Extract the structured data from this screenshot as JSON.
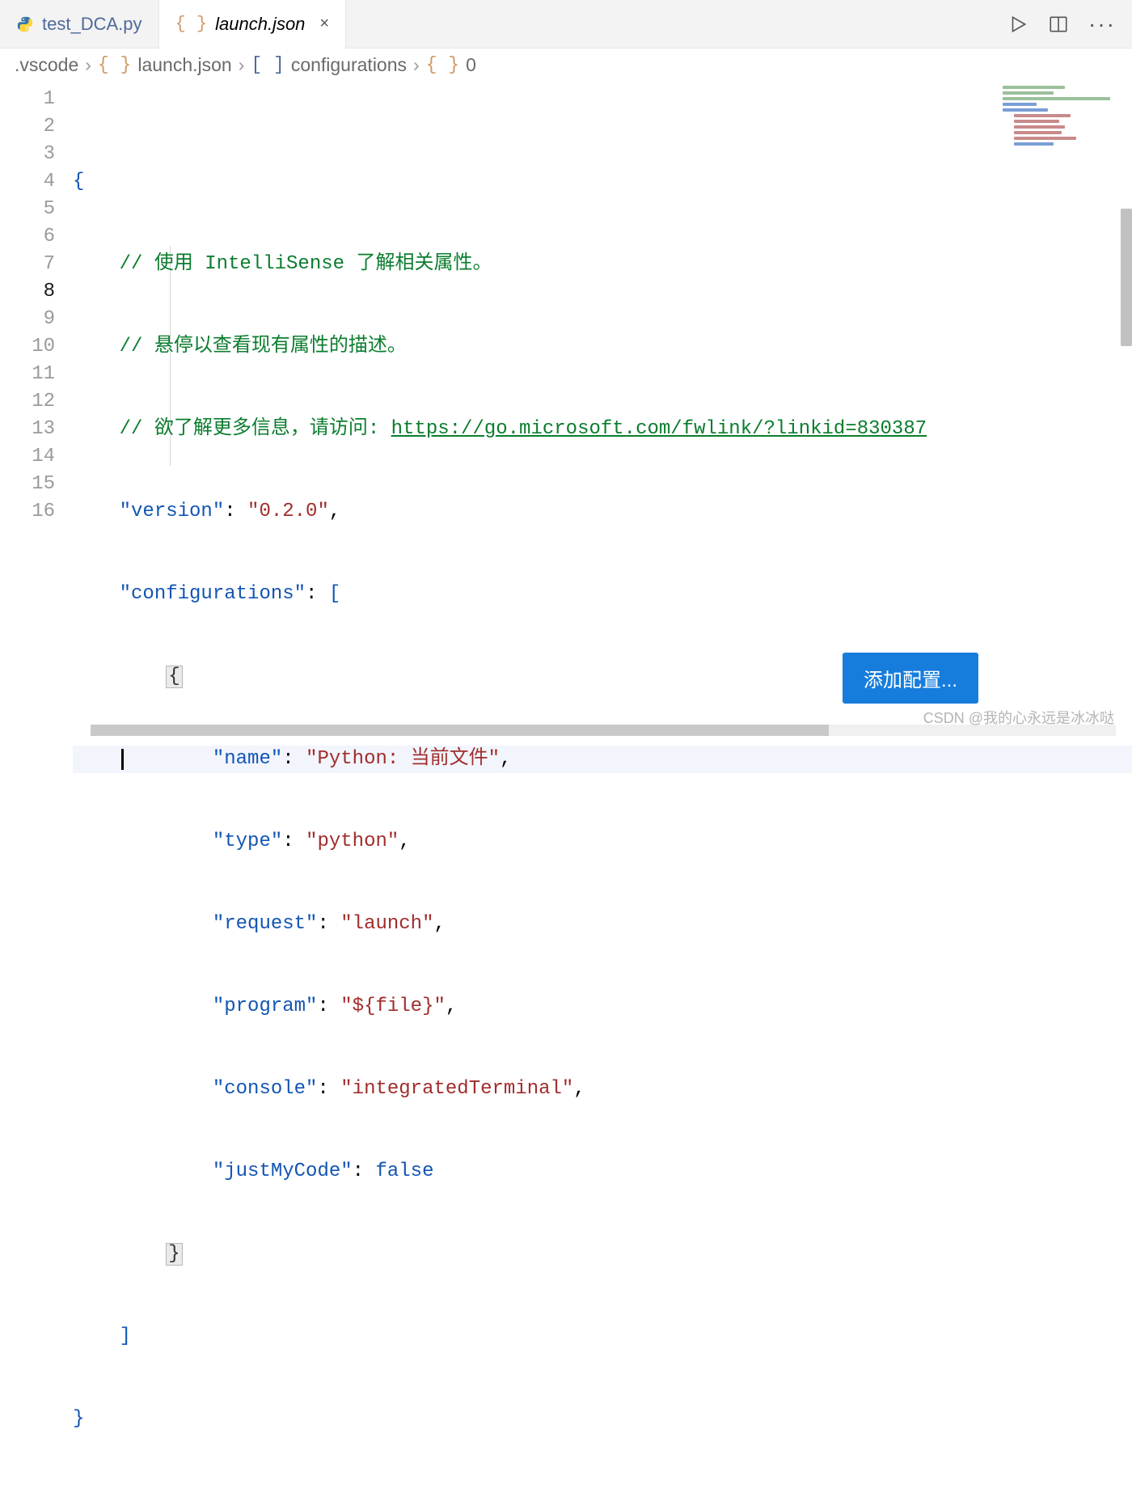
{
  "tabs": {
    "inactive": {
      "label": "test_DCA.py"
    },
    "active": {
      "label": "launch.json",
      "close": "×"
    }
  },
  "breadcrumb": {
    "folder": ".vscode",
    "file": "launch.json",
    "key": "configurations",
    "index": "0"
  },
  "gutter": [
    "1",
    "2",
    "3",
    "4",
    "5",
    "6",
    "7",
    "8",
    "9",
    "10",
    "11",
    "12",
    "13",
    "14",
    "15",
    "16"
  ],
  "code": {
    "l1": "{",
    "l2_c": "// 使用 IntelliSense 了解相关属性。",
    "l3_c": "// 悬停以查看现有属性的描述。",
    "l4_c_prefix": "// 欲了解更多信息，请访问: ",
    "l4_link": "https://go.microsoft.com/fwlink/?linkid=830387",
    "l5_key": "\"version\"",
    "l5_val": "\"0.2.0\"",
    "l6_key": "\"configurations\"",
    "l7": "{",
    "l8_key": "\"name\"",
    "l8_val": "\"Python: 当前文件\"",
    "l9_key": "\"type\"",
    "l9_val": "\"python\"",
    "l10_key": "\"request\"",
    "l10_val": "\"launch\"",
    "l11_key": "\"program\"",
    "l11_val": "\"${file}\"",
    "l12_key": "\"console\"",
    "l12_val": "\"integratedTerminal\"",
    "l13_key": "\"justMyCode\"",
    "l13_val": "false",
    "l14": "}",
    "l15": "]",
    "l16": "}",
    "comma": ",",
    "colon": ":",
    "bracket_open": "["
  },
  "button": {
    "add_config": "添加配置..."
  },
  "watermark": "CSDN @我的心永远是冰冰哒"
}
